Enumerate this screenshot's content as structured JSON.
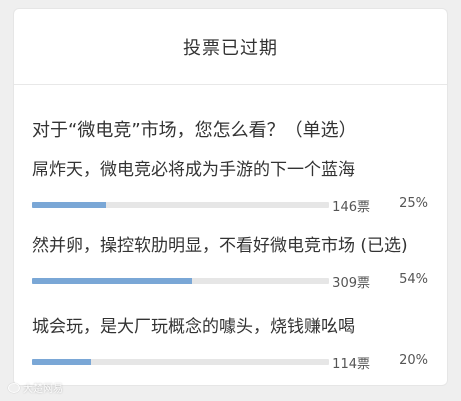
{
  "poll": {
    "header_title": "投票已过期",
    "question": "对于“微电竞”市场，您怎么看？（单选）",
    "accent_color": "#7aa7d6",
    "options": [
      {
        "label": "屌炸天，微电竞必将成为手游的下一个蓝海",
        "votes": "146票",
        "percent": "25%",
        "fill_fraction": 0.25
      },
      {
        "label": "然并卵，操控软肋明显，不看好微电竞市场 (已选)",
        "votes": "309票",
        "percent": "54%",
        "fill_fraction": 0.54
      },
      {
        "label": "城会玩，是大厂玩概念的噱头，烧钱赚吆喝",
        "votes": "114票",
        "percent": "20%",
        "fill_fraction": 0.2
      }
    ]
  },
  "watermark": {
    "icon": "weibo-logo-icon",
    "text": "大楚网易"
  }
}
